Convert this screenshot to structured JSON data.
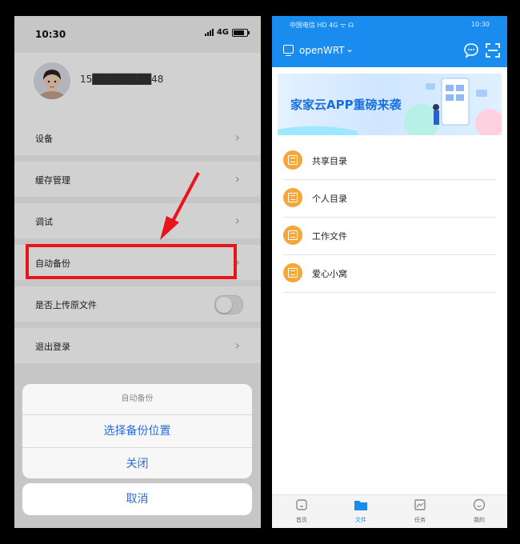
{
  "left_screen": {
    "status_bar": {
      "time": "10:30",
      "network": "4G"
    },
    "profile": {
      "phone_number": "15████████48"
    },
    "menu_items": [
      {
        "label": "设备"
      },
      {
        "label": "缓存管理"
      },
      {
        "label": "调试"
      },
      {
        "label": "自动备份"
      },
      {
        "label": "是否上传原文件",
        "toggle": "off"
      },
      {
        "label": "退出登录"
      }
    ],
    "action_sheet": {
      "title": "自动备份",
      "options": [
        "选择备份位置",
        "关闭"
      ],
      "cancel": "取消"
    },
    "annotation_color": "#e8151b"
  },
  "right_screen": {
    "status_bar": {
      "carrier": "中国电信 HD 4G ᯤ ☊",
      "time": "10:30"
    },
    "header": {
      "title": "openWRT",
      "bg_color": "#1a8cf0"
    },
    "banner": {
      "text": "家家云APP重磅来袭"
    },
    "folders": [
      {
        "label": "共享目录"
      },
      {
        "label": "个人目录"
      },
      {
        "label": "工作文件"
      },
      {
        "label": "爱心小窝"
      }
    ],
    "tabbar": [
      {
        "label": "首页",
        "icon": "home-icon"
      },
      {
        "label": "文件",
        "icon": "folder-icon",
        "active": true
      },
      {
        "label": "任务",
        "icon": "task-icon"
      },
      {
        "label": "我的",
        "icon": "profile-icon"
      }
    ],
    "folder_icon_color": "#f4a73a"
  }
}
